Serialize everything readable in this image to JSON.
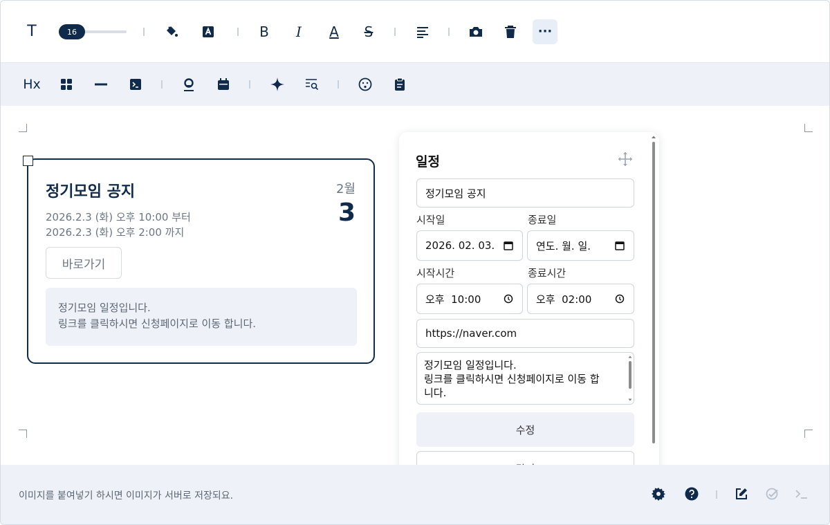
{
  "toolbar_format": {
    "font_size_value": "16",
    "items": [
      "text-style-icon",
      "font-size-slider",
      "fill-color-icon",
      "text-background-icon",
      "bold-icon",
      "italic-icon",
      "underline-icon",
      "strikethrough-icon",
      "align-left-icon",
      "camera-icon",
      "trash-icon",
      "more-icon"
    ],
    "glyphs": {
      "text": "T",
      "bold": "B",
      "italic": "I",
      "underline": "A",
      "strike": "S",
      "more": "···"
    }
  },
  "toolbar_insert": {
    "glyphs": {
      "heading": "Hx"
    },
    "items": [
      "heading-icon",
      "layout-grid-icon",
      "horizontal-rule-icon",
      "code-block-icon",
      "location-pin-icon",
      "calendar-icon",
      "sparkle-icon",
      "search-text-icon",
      "emoji-icon",
      "clipboard-icon"
    ]
  },
  "card": {
    "title": "정기모임 공지",
    "month": "2월",
    "day": "3",
    "start": "2026.2.3 (화) 오후 10:00 부터",
    "end": "2026.2.3 (화) 오후 2:00 까지",
    "link_button": "바로가기",
    "description_line1": "정기모임 일정입니다.",
    "description_line2": "링크를 클릭하시면 신청페이지로 이동 합니다."
  },
  "panel": {
    "title": "일정",
    "title_value": "정기모임 공지",
    "start_date_label": "시작일",
    "start_date_value": "2026. 02. 03.",
    "end_date_label": "종료일",
    "end_date_value": "연도. 월. 일.",
    "start_time_label": "시작시간",
    "start_time_value": "오후  10:00",
    "end_time_label": "종료시간",
    "end_time_value": "오후  02:00",
    "url_value": "https://naver.com",
    "desc_line1": "정기모임 일정입니다.",
    "desc_line2": "링크를 클릭하시면 신청페이지로 이동 합",
    "desc_line3": "니다.",
    "edit_button": "수정",
    "close_button": "닫기"
  },
  "footer": {
    "hint": "이미지를 붙여넣기 하시면 이미지가 서버로 저장되요.",
    "items": [
      "settings-icon",
      "help-icon",
      "edit-icon",
      "check-disabled-icon",
      "terminal-icon"
    ]
  },
  "colors": {
    "navy": "#0f2a4a",
    "toolbar_bg": "#eef2f8",
    "muted": "#6b7785"
  }
}
